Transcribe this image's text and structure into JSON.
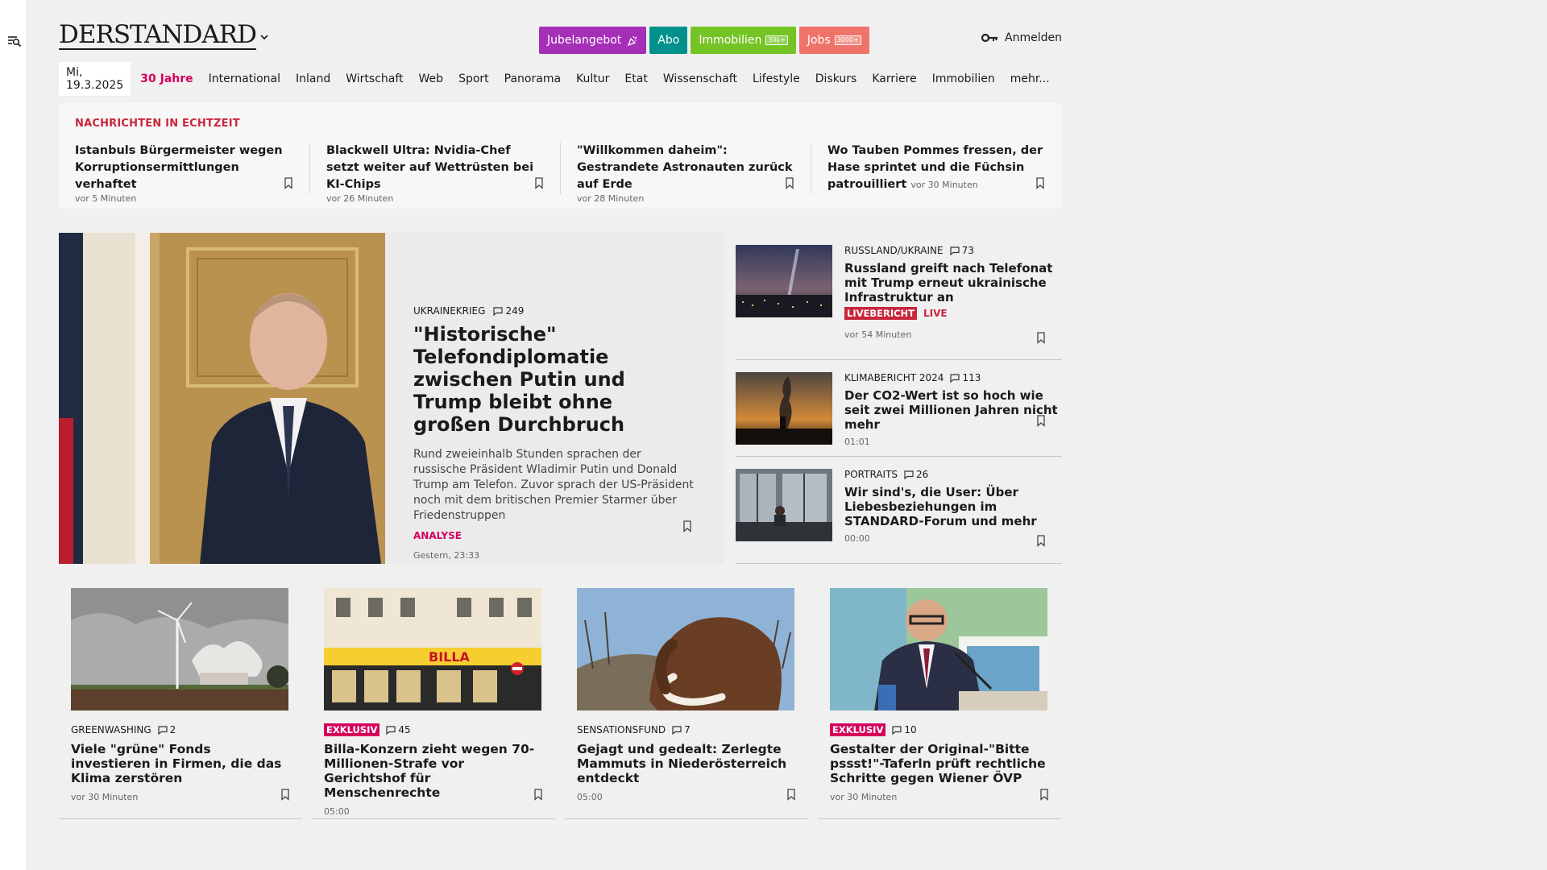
{
  "logo": "DERSTANDARD",
  "header": {
    "pills": [
      {
        "label": "Jubelangebot",
        "tag": "",
        "color": "#a530b7"
      },
      {
        "label": "Abo",
        "tag": "",
        "color": "#00918c"
      },
      {
        "label": "Immobilien",
        "tag": "30k+",
        "color": "#75c426"
      },
      {
        "label": "Jobs",
        "tag": "3000+",
        "color": "#f0736b"
      }
    ],
    "login": "Anmelden"
  },
  "nav": {
    "date": "Mi, 19.3.2025",
    "items": [
      "30 Jahre",
      "International",
      "Inland",
      "Wirtschaft",
      "Web",
      "Sport",
      "Panorama",
      "Kultur",
      "Etat",
      "Wissenschaft",
      "Lifestyle",
      "Diskurs",
      "Karriere",
      "Immobilien",
      "mehr..."
    ]
  },
  "ticker": {
    "heading": "NACHRICHTEN IN ECHTZEIT",
    "items": [
      {
        "title": "Istanbuls Bürgermeister wegen Korruptionsermittlungen verhaftet",
        "time": "vor 5 Minuten"
      },
      {
        "title": "Blackwell Ultra: Nvidia-Chef setzt weiter auf Wettrüsten bei KI-Chips",
        "time": "vor 26 Minuten"
      },
      {
        "title": "\"Willkommen daheim\": Gestrandete Astronauten zurück auf Erde",
        "time": "vor 28 Minuten"
      },
      {
        "title": "Wo Tauben Pommes fressen, der Hase sprintet und die Füchsin patrouilliert",
        "time": "vor 30 Minuten"
      }
    ]
  },
  "hero": {
    "kicker": "UKRAINEKRIEG",
    "comments": "249",
    "title": "\"Historische\" Telefondiplomatie zwischen Putin und Trump bleibt ohne großen Durchbruch",
    "lead": "Rund zweieinhalb Stunden sprachen der russische Präsident Wladimir Putin und Donald Trump am Telefon. Zuvor sprach der US-Präsident noch mit dem britischen Premier Starmer über Friedenstruppen",
    "label": "ANALYSE",
    "time": "Gestern, 23:33"
  },
  "side": [
    {
      "kicker": "RUSSLAND/UKRAINE",
      "comments": "73",
      "title": "Russland greift nach Telefonat mit Trump erneut ukrainische Infrastruktur an",
      "badge": "LIVEBERICHT",
      "live": "LIVE",
      "time": "vor 54 Minuten"
    },
    {
      "kicker": "KLIMABERICHT 2024",
      "comments": "113",
      "title": "Der CO2-Wert ist so hoch wie seit zwei Millionen Jahren nicht mehr",
      "time": "01:01"
    },
    {
      "kicker": "PORTRAITS",
      "comments": "26",
      "title": "Wir sind's, die User: Über Liebesbeziehungen im STANDARD-Forum und mehr",
      "time": "00:00"
    }
  ],
  "cards": [
    {
      "kicker": "GREENWASHING",
      "badge": "",
      "comments": "2",
      "title": "Viele \"grüne\" Fonds investieren in Firmen, die das Klima zerstören",
      "time": "vor 30 Minuten"
    },
    {
      "kicker": "",
      "badge": "EXKLUSIV",
      "comments": "45",
      "title": "Billa-Konzern zieht wegen 70-Millionen-Strafe vor Gerichtshof für Menschenrechte",
      "time": "05:00"
    },
    {
      "kicker": "SENSATIONSFUND",
      "badge": "",
      "comments": "7",
      "title": "Gejagt und gedealt: Zerlegte Mammuts in Niederösterreich entdeckt",
      "time": "05:00"
    },
    {
      "kicker": "",
      "badge": "EXKLUSIV",
      "comments": "10",
      "title": "Gestalter der Original-\"Bitte pssst!\"-Taferln prüft rechtliche Schritte gegen Wiener ÖVP",
      "time": "vor 30 Minuten"
    }
  ],
  "images": {
    "billa_sign": "BILLA"
  },
  "colors": {
    "accent": "#d6005c",
    "live": "#c9263c",
    "exklusiv": "#d6005c"
  }
}
